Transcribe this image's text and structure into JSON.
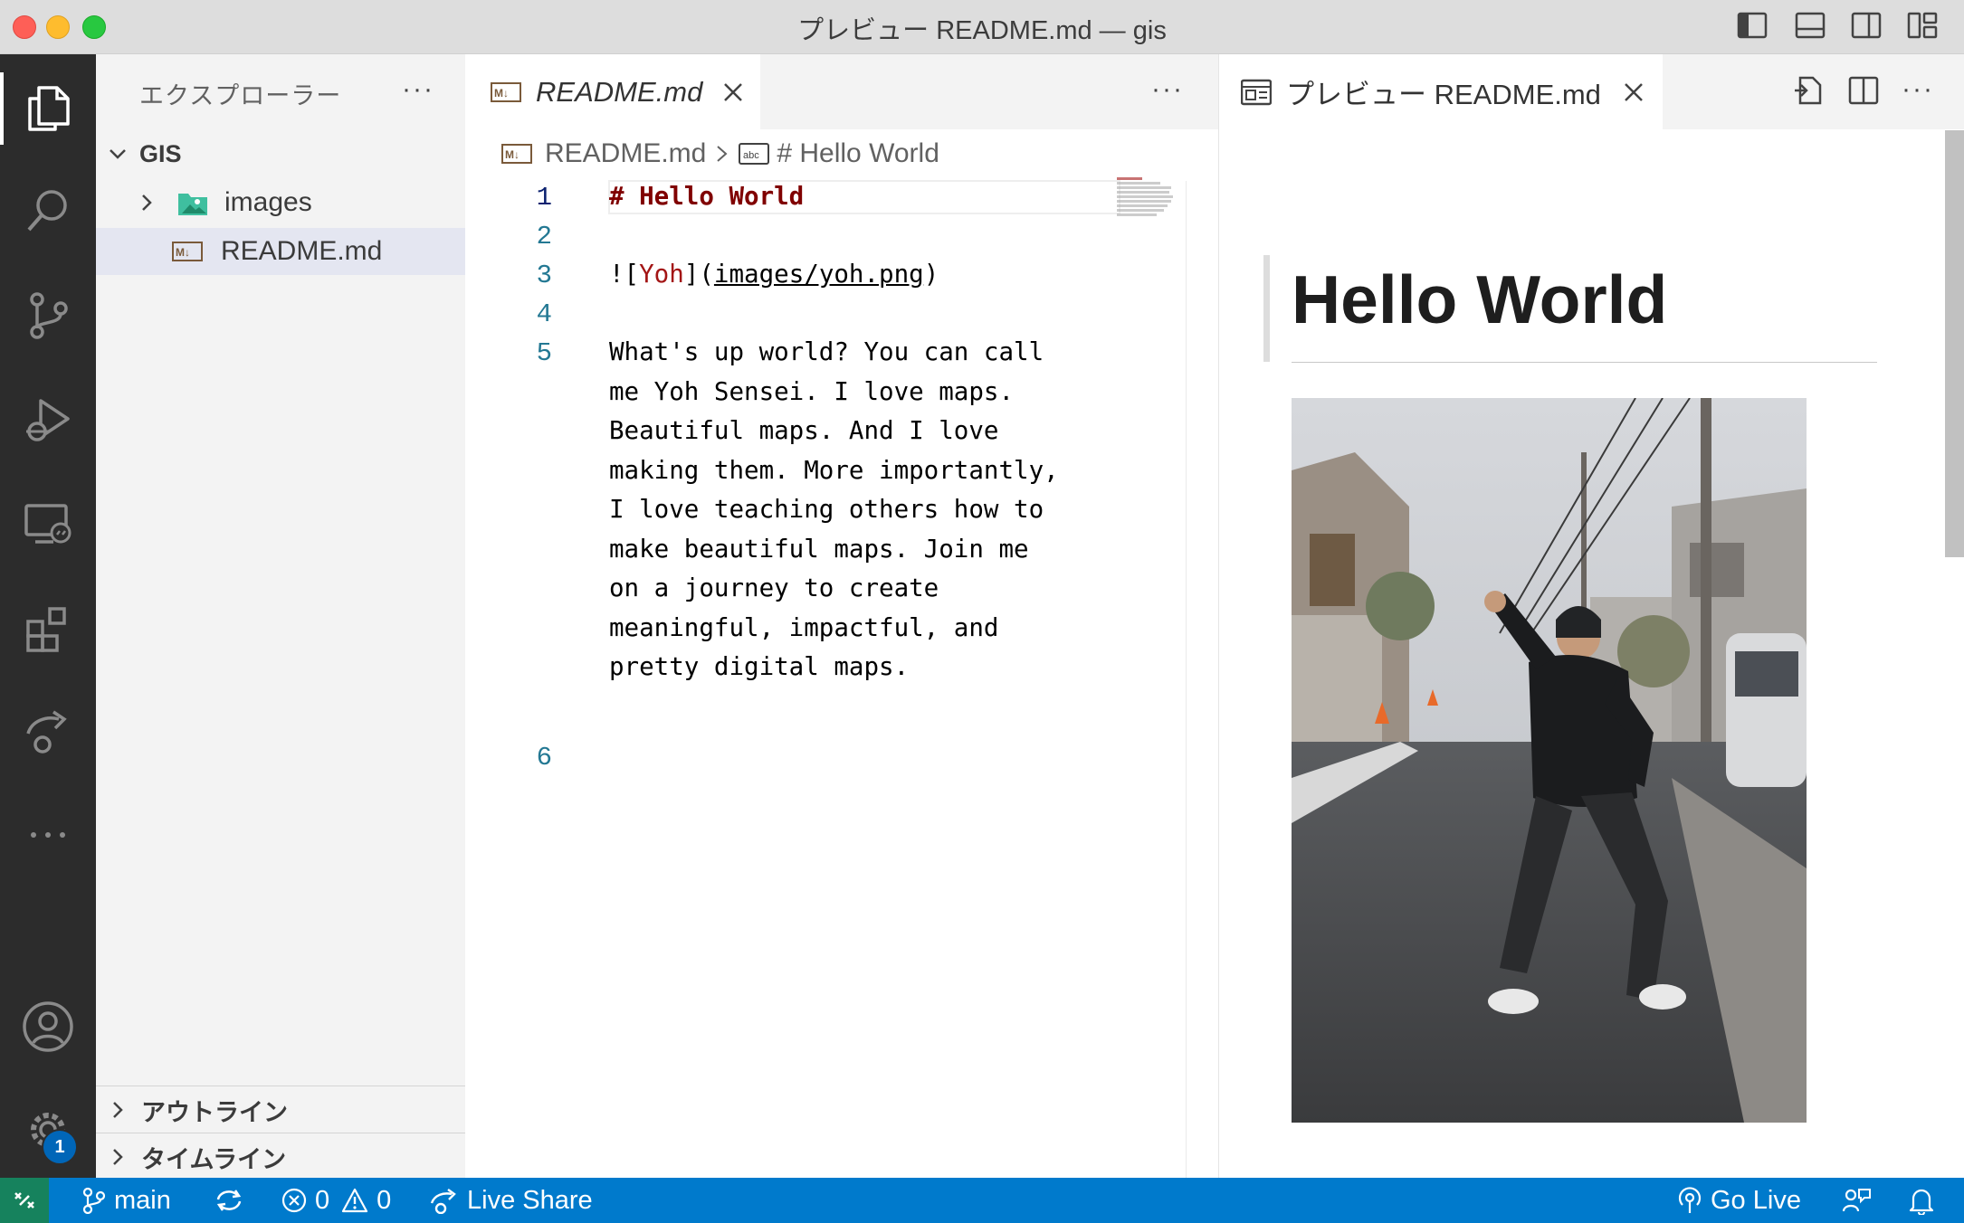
{
  "window": {
    "title": "プレビュー README.md — gis"
  },
  "activity_bar": {
    "items": [
      "explorer-icon",
      "search-icon",
      "source-control-icon",
      "run-debug-icon",
      "remote-explorer-icon",
      "extensions-icon",
      "live-share-icon",
      "more-icon"
    ],
    "bottom": [
      "accounts-icon",
      "manage-gear-icon"
    ],
    "badge": "1"
  },
  "sidebar": {
    "title": "エクスプローラー",
    "more": "···",
    "root": "GIS",
    "items": [
      {
        "label": "images",
        "type": "folder"
      },
      {
        "label": "README.md",
        "type": "markdown"
      }
    ],
    "outline": "アウトライン",
    "timeline": "タイムライン"
  },
  "editor": {
    "tab_label": "README.md",
    "more": "···",
    "breadcrumb": {
      "file": "README.md",
      "symbol": "# Hello World"
    },
    "line_numbers": [
      "1",
      "2",
      "3",
      "4",
      "5",
      "6"
    ],
    "lines": {
      "l1": "# Hello World",
      "l3_prefix": "![",
      "l3_alt": "Yoh",
      "l3_mid": "](",
      "l3_link": "images/yoh.png",
      "l3_suffix": ")",
      "l5": [
        "What's up world? You can call",
        "me Yoh Sensei. I love maps.",
        "Beautiful maps. And I love",
        "making them. More importantly,",
        "I love teaching others how to",
        "make beautiful maps. Join me",
        "on a journey to create",
        "meaningful, impactful, and",
        "pretty digital maps."
      ]
    }
  },
  "preview": {
    "tab_label": "プレビュー README.md",
    "more": "···",
    "heading": "Hello World"
  },
  "status_bar": {
    "branch": "main",
    "errors": "0",
    "warnings": "0",
    "live_share": "Live Share",
    "go_live": "Go Live"
  },
  "colors": {
    "status_bar": "#007acc",
    "activity_bar": "#2c2c2c",
    "heading_code": "#800000",
    "remote": "#16825d"
  }
}
